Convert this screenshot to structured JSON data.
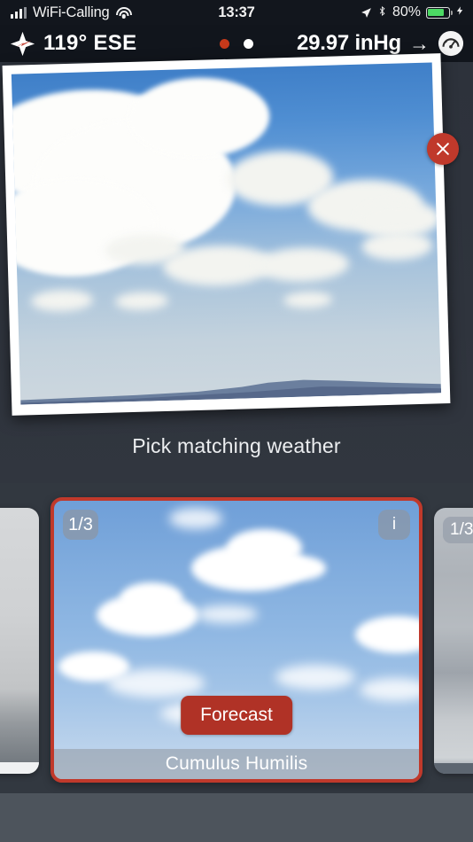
{
  "status_bar": {
    "carrier": "WiFi-Calling",
    "signal_icon": "cellular-signal-icon",
    "wifi_icon": "wifi-icon",
    "time": "13:37",
    "location_icon": "location-arrow-icon",
    "bluetooth_icon": "bluetooth-icon",
    "battery_percent": "80%",
    "battery_icon": "battery-icon",
    "battery_level": 80,
    "battery_color": "#4cd964",
    "charging_icon": "lightning-bolt-icon"
  },
  "info_bar": {
    "compass_icon": "compass-rose-icon",
    "wind": "119° ESE",
    "page_dots": [
      {
        "name": "page-dot-1",
        "active": true,
        "color": "#c5391a"
      },
      {
        "name": "page-dot-2",
        "active": false,
        "color": "#ffffff"
      }
    ],
    "pressure": "29.97 inHg",
    "pressure_trend_icon": "arrow-right-icon",
    "pressure_trend": "→",
    "barometer_icon": "barometer-gauge-icon"
  },
  "photo_panel": {
    "close_icon": "close-x-icon",
    "photo_alt": "photo-of-cumulus-clouds-over-hills",
    "prompt": "Pick matching weather"
  },
  "carousel": {
    "left_peek": {
      "name": "carousel-card-previous",
      "image_alt": "foggy-snowy-forest-photo"
    },
    "selected_card": {
      "name": "carousel-card-selected",
      "badge": "1/3",
      "info_label": "i",
      "forecast_label": "Forecast",
      "cloud_name": "Cumulus Humilis",
      "border_color": "#c0392b",
      "image_alt": "blue-sky-with-fair-weather-cumulus"
    },
    "right_peek": {
      "name": "carousel-card-next",
      "badge": "1/3",
      "image_alt": "overcast-gray-sky-photo"
    }
  },
  "theme": {
    "background": "#2d323b",
    "bottom_bar": "#4d545c",
    "accent_red": "#c0392b",
    "status_bar_bg": "#12161d"
  }
}
